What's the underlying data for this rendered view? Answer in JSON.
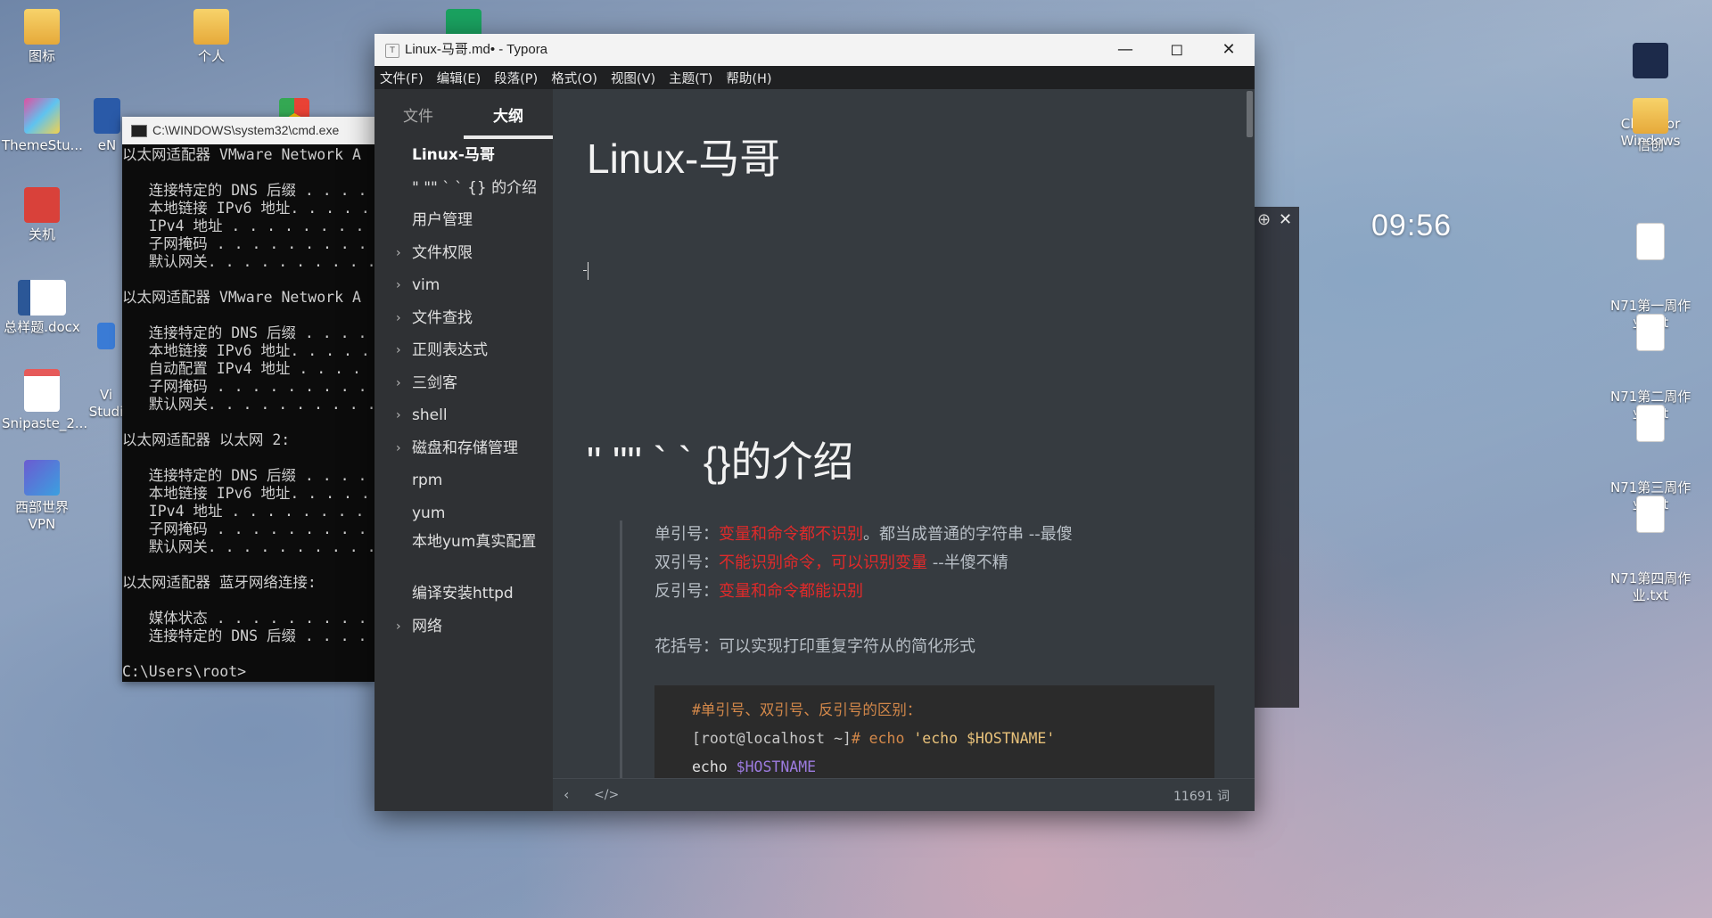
{
  "desktop_icons": [
    {
      "id": "tubiao",
      "label": "图标"
    },
    {
      "id": "geren",
      "label": "个人"
    },
    {
      "id": "themestudio",
      "label": "ThemeStu..."
    },
    {
      "id": "guanji",
      "label": "关机"
    },
    {
      "id": "zongyangti",
      "label": "总样题.docx"
    },
    {
      "id": "snipaste",
      "label": "Snipaste_2..."
    },
    {
      "id": "vpn",
      "label": "西部世界VPN"
    },
    {
      "id": "en",
      "label": "eN"
    },
    {
      "id": "vi",
      "label": "Vi\nStudi"
    },
    {
      "id": "clash",
      "label": "Clash for\nWindows"
    },
    {
      "id": "xinchuang",
      "label": "信创"
    },
    {
      "id": "n71_1",
      "label": "N71第一周作\n业.txt"
    },
    {
      "id": "n71_2",
      "label": "N71第二周作\n业.txt"
    },
    {
      "id": "n71_3",
      "label": "N71第三周作\n业.txt"
    },
    {
      "id": "n71_4",
      "label": "N71第四周作\n业.txt"
    }
  ],
  "clock": {
    "time": "09:56"
  },
  "cmd": {
    "title": "C:\\WINDOWS\\system32\\cmd.exe",
    "lines": [
      "以太网适配器 VMware Network A",
      "",
      "   连接特定的 DNS 后缀 . . . .",
      "   本地链接 IPv6 地址. . . . .",
      "   IPv4 地址 . . . . . . . . .",
      "   子网掩码 . . . . . . . . .",
      "   默认网关. . . . . . . . . .",
      "",
      "以太网适配器 VMware Network A",
      "",
      "   连接特定的 DNS 后缀 . . . .",
      "   本地链接 IPv6 地址. . . . .",
      "   自动配置 IPv4 地址 . . . .",
      "   子网掩码 . . . . . . . . .",
      "   默认网关. . . . . . . . . .",
      "",
      "以太网适配器 以太网 2:",
      "",
      "   连接特定的 DNS 后缀 . . . .",
      "   本地链接 IPv6 地址. . . . .",
      "   IPv4 地址 . . . . . . . . .",
      "   子网掩码 . . . . . . . . .",
      "   默认网关. . . . . . . . . .",
      "",
      "以太网适配器 蓝牙网络连接:",
      "",
      "   媒体状态 . . . . . . . . .",
      "   连接特定的 DNS 后缀 . . . .",
      "",
      "C:\\Users\\root>"
    ]
  },
  "typora": {
    "title": "Linux-马哥.md• - Typora",
    "menu": [
      "文件(F)",
      "编辑(E)",
      "段落(P)",
      "格式(O)",
      "视图(V)",
      "主题(T)",
      "帮助(H)"
    ],
    "sidebar_tabs": {
      "files": "文件",
      "outline": "大纲"
    },
    "outline": [
      {
        "label": "Linux-马哥",
        "h1": true,
        "chevron": false
      },
      {
        "label": "\" \"\" ` ` {} 的介绍",
        "chevron": false
      },
      {
        "label": "用户管理",
        "chevron": false
      },
      {
        "label": "文件权限",
        "chevron": true
      },
      {
        "label": "vim",
        "chevron": true
      },
      {
        "label": "文件查找",
        "chevron": true
      },
      {
        "label": "正则表达式",
        "chevron": true
      },
      {
        "label": "三剑客",
        "chevron": true
      },
      {
        "label": "shell",
        "chevron": true
      },
      {
        "label": "磁盘和存储管理",
        "chevron": true
      },
      {
        "label": "rpm",
        "chevron": false
      },
      {
        "label": "yum",
        "chevron": false
      },
      {
        "label": "本地yum真实配置",
        "chevron": false,
        "two": true
      },
      {
        "label": "编译安装httpd",
        "chevron": false
      },
      {
        "label": "网络",
        "chevron": true
      }
    ],
    "doc": {
      "h1": "Linux-马哥",
      "h2": "\" \"\" ` ` {}的介绍",
      "quote": {
        "l1_label": "单引号：",
        "l1_red": "变量和命令都不识别",
        "l1_rest": "。都当成普通的字符串 --最傻",
        "l2_label": "双引号：",
        "l2_red": "不能识别命令，可以识别变量",
        "l2_rest": " --半傻不精",
        "l3_label": "反引号：",
        "l3_red": "变量和命令都能识别",
        "l4": "花括号：可以实现打印重复字符从的简化形式"
      },
      "code": {
        "l1": "#单引号、双引号、反引号的区别：",
        "l2_prompt": "[root@localhost ~]",
        "l2_cmd": "# echo ",
        "l2_str": "'echo $HOSTNAME'",
        "l3_kw": "echo ",
        "l3_var": "$HOSTNAME"
      }
    },
    "footer": {
      "word_count": "11691 词"
    }
  }
}
